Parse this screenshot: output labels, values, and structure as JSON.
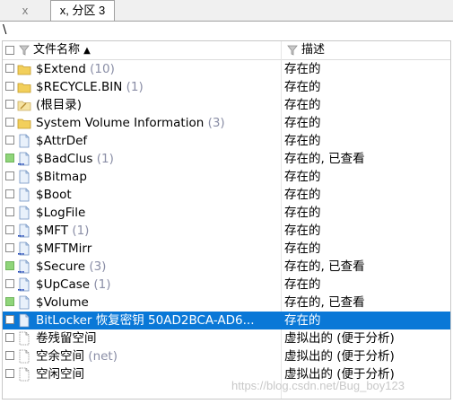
{
  "tabs": [
    {
      "label": "x"
    },
    {
      "label": "x, 分区 3"
    }
  ],
  "path": "\\",
  "columns": {
    "name": "文件名称",
    "desc": "描述"
  },
  "rows": [
    {
      "name": "$Extend",
      "count": "(10)",
      "desc": "存在的",
      "icon": "folder-icon",
      "checked": false,
      "selected": false
    },
    {
      "name": "$RECYCLE.BIN",
      "count": "(1)",
      "desc": "存在的",
      "icon": "folder-icon",
      "checked": false,
      "selected": false
    },
    {
      "name": "(根目录)",
      "count": "",
      "desc": "存在的",
      "icon": "root-folder-icon",
      "checked": false,
      "selected": false
    },
    {
      "name": "System Volume Information",
      "count": "(3)",
      "desc": "存在的",
      "icon": "folder-icon",
      "checked": false,
      "selected": false
    },
    {
      "name": "$AttrDef",
      "count": "",
      "desc": "存在的",
      "icon": "file-icon",
      "checked": false,
      "selected": false
    },
    {
      "name": "$BadClus",
      "count": "(1)",
      "desc": "存在的, 已查看",
      "icon": "file-stream-icon",
      "checked": true,
      "selected": false
    },
    {
      "name": "$Bitmap",
      "count": "",
      "desc": "存在的",
      "icon": "file-icon",
      "checked": false,
      "selected": false
    },
    {
      "name": "$Boot",
      "count": "",
      "desc": "存在的",
      "icon": "file-icon",
      "checked": false,
      "selected": false
    },
    {
      "name": "$LogFile",
      "count": "",
      "desc": "存在的",
      "icon": "file-icon",
      "checked": false,
      "selected": false
    },
    {
      "name": "$MFT",
      "count": "(1)",
      "desc": "存在的",
      "icon": "file-stream-icon",
      "checked": false,
      "selected": false
    },
    {
      "name": "$MFTMirr",
      "count": "",
      "desc": "存在的",
      "icon": "file-stream-icon",
      "checked": false,
      "selected": false
    },
    {
      "name": "$Secure",
      "count": "(3)",
      "desc": "存在的, 已查看",
      "icon": "file-stream-icon",
      "checked": true,
      "selected": false
    },
    {
      "name": "$UpCase",
      "count": "(1)",
      "desc": "存在的",
      "icon": "file-stream-icon",
      "checked": false,
      "selected": false
    },
    {
      "name": "$Volume",
      "count": "",
      "desc": "存在的, 已查看",
      "icon": "file-icon",
      "checked": true,
      "selected": false
    },
    {
      "name": "BitLocker 恢复密钥 50AD2BCA-AD6...",
      "count": "",
      "desc": "存在的",
      "icon": "file-icon",
      "checked": false,
      "selected": true
    },
    {
      "name": "卷残留空间",
      "count": "",
      "desc": "虚拟出的 (便于分析)",
      "icon": "virtual-file-icon",
      "checked": false,
      "selected": false
    },
    {
      "name": "空余空间",
      "count": "(net)",
      "desc": "虚拟出的 (便于分析)",
      "icon": "virtual-file-icon",
      "checked": false,
      "selected": false
    },
    {
      "name": "空闲空间",
      "count": "",
      "desc": "虚拟出的 (便于分析)",
      "icon": "virtual-file-icon",
      "checked": false,
      "selected": false
    }
  ],
  "watermark": "https://blog.csdn.net/Bug_boy123",
  "colors": {
    "selection": "#0a78d7",
    "folder": "#f2cf5b",
    "checked": "#8fd57a"
  }
}
